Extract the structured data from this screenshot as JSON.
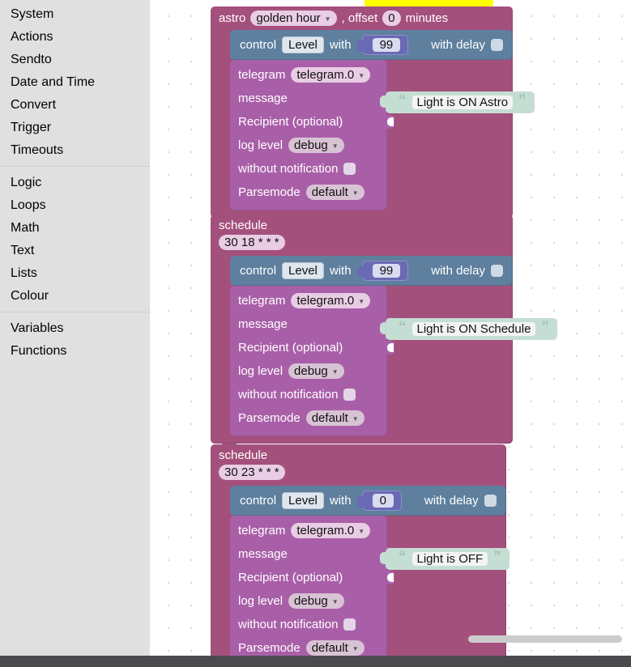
{
  "toolbox": {
    "groups": [
      {
        "items": [
          "System",
          "Actions",
          "Sendto",
          "Date and Time",
          "Convert",
          "Trigger",
          "Timeouts"
        ]
      },
      {
        "items": [
          "Logic",
          "Loops",
          "Math",
          "Text",
          "Lists",
          "Colour"
        ]
      },
      {
        "items": [
          "Variables",
          "Functions"
        ]
      }
    ]
  },
  "workspace": {
    "tooltip": {
      "text": ""
    },
    "stacks": [
      {
        "id": "astro-stack",
        "event": {
          "kind": "astro",
          "label": "astro",
          "pattern": "golden hour",
          "offset_label": ", offset",
          "offset_value": "0",
          "offset_unit": "minutes"
        },
        "control": {
          "label": "control",
          "object": "Level",
          "with_label": "with",
          "value": "99",
          "delay_label": "with delay",
          "delay_checked": false
        },
        "telegram": {
          "label": "telegram",
          "instance": "telegram.0",
          "message_label": "message",
          "message_value": "Light is ON Astro",
          "recipient_label": "Recipient (optional)",
          "loglevel_label": "log level",
          "loglevel_value": "debug",
          "silent_label": "without notification",
          "silent_checked": false,
          "parsemode_label": "Parsemode",
          "parsemode_value": "default"
        }
      },
      {
        "id": "schedule-on-stack",
        "event": {
          "kind": "schedule",
          "label": "schedule",
          "cron": "30 18 * * *"
        },
        "control": {
          "label": "control",
          "object": "Level",
          "with_label": "with",
          "value": "99",
          "delay_label": "with delay",
          "delay_checked": false
        },
        "telegram": {
          "label": "telegram",
          "instance": "telegram.0",
          "message_label": "message",
          "message_value": "Light is ON Schedule",
          "recipient_label": "Recipient (optional)",
          "loglevel_label": "log level",
          "loglevel_value": "debug",
          "silent_label": "without notification",
          "silent_checked": false,
          "parsemode_label": "Parsemode",
          "parsemode_value": "default"
        }
      },
      {
        "id": "schedule-off-stack",
        "event": {
          "kind": "schedule",
          "label": "schedule",
          "cron": "30 23 * * *"
        },
        "control": {
          "label": "control",
          "object": "Level",
          "with_label": "with",
          "value": "0",
          "delay_label": "with delay",
          "delay_checked": false
        },
        "telegram": {
          "label": "telegram",
          "instance": "telegram.0",
          "message_label": "message",
          "message_value": "Light is OFF",
          "recipient_label": "Recipient (optional)",
          "loglevel_label": "log level",
          "loglevel_value": "debug",
          "silent_label": "without notification",
          "silent_checked": false,
          "parsemode_label": "Parsemode",
          "parsemode_value": "default"
        }
      }
    ]
  },
  "colors": {
    "event_astro": "#a4507c",
    "event_schedule": "#a4507c",
    "control_block": "#5e7f9e",
    "telegram_block": "#a95fa8",
    "number_block": "#6a6ab4",
    "text_block": "#c5ded3",
    "toolbox_bg": "#e0e0e0",
    "tooltip": "#ffff00"
  }
}
